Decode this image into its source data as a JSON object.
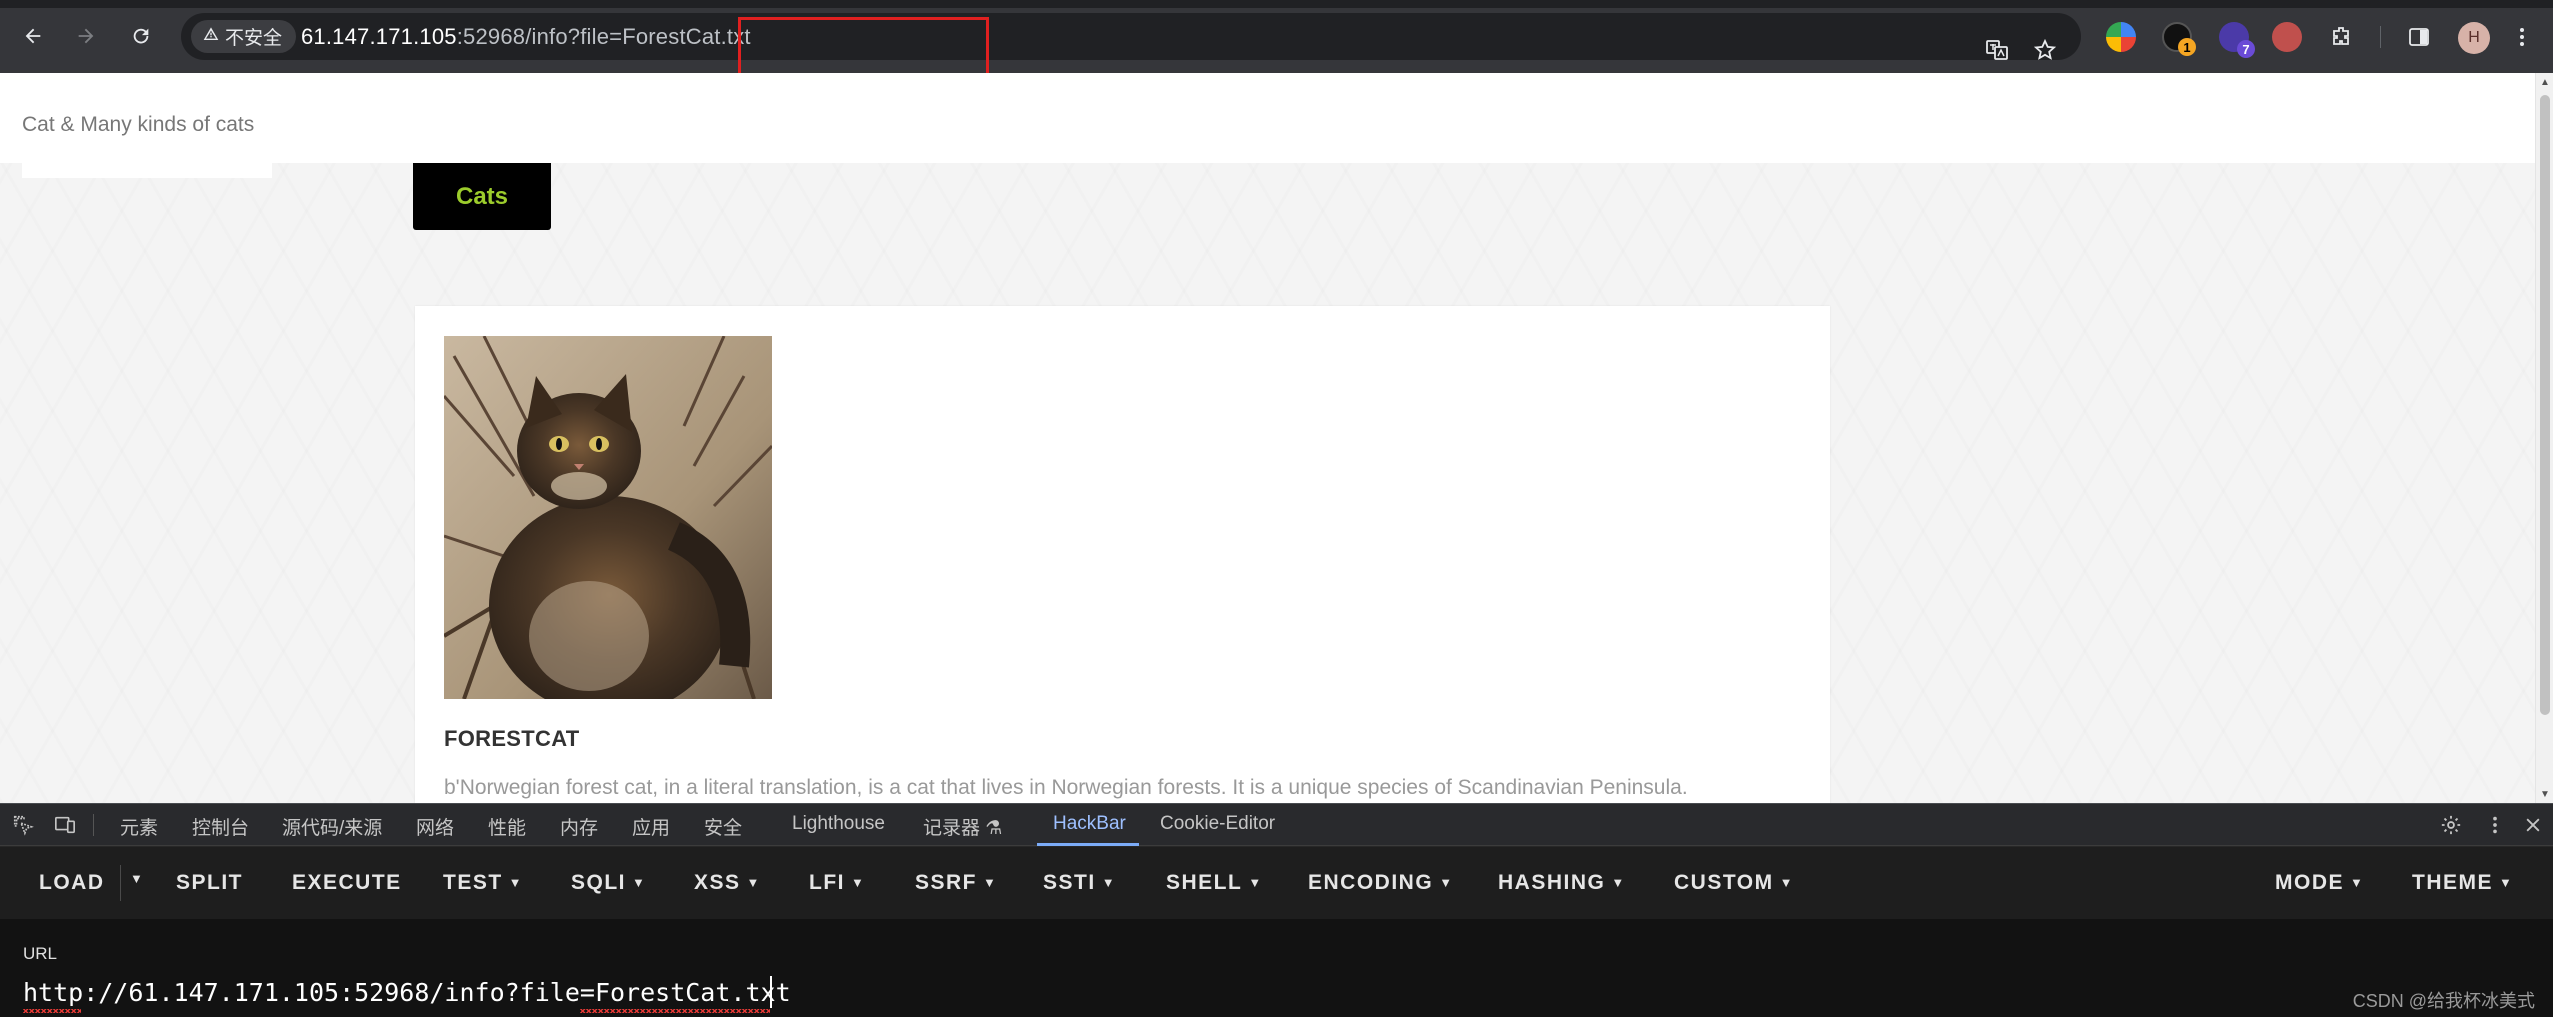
{
  "browser": {
    "security_label": "不安全",
    "url_host": "61.147.171.105",
    "url_rest": ":52968/info?file=ForestCat.txt",
    "accent": "#e02020",
    "extension_badges": [
      "1",
      "7"
    ],
    "profile_initial": "H",
    "icons": [
      "back-icon",
      "forward-icon",
      "reload-icon",
      "warning-icon",
      "translate-icon",
      "star-icon",
      "puzzle-icon",
      "sidepanel-icon"
    ]
  },
  "page": {
    "brand": "Cat & Many kinds of cats",
    "nav_button": "Cats",
    "nav_button_color": "#9ccc2c",
    "card": {
      "title": "FORESTCAT",
      "description": "b'Norwegian forest cat, in a literal translation, is a cat that lives in Norwegian forests. It is a unique species of Scandinavian Peninsula."
    }
  },
  "devtools": {
    "tabs": [
      "元素",
      "控制台",
      "源代码/来源",
      "网络",
      "性能",
      "内存",
      "应用",
      "安全",
      "Lighthouse",
      "记录器 ⚗",
      "HackBar",
      "Cookie-Editor"
    ],
    "active_tab": "HackBar",
    "active_color": "#7cacf8"
  },
  "hackbar": {
    "buttons": [
      "LOAD",
      "SPLIT",
      "EXECUTE",
      "TEST",
      "SQLI",
      "XSS",
      "LFI",
      "SSRF",
      "SSTI",
      "SHELL",
      "ENCODING",
      "HASHING",
      "CUSTOM"
    ],
    "right_buttons": [
      "MODE",
      "THEME"
    ],
    "url_label": "URL",
    "url_value": "http://61.147.171.105:52968/info?file=ForestCat.txt"
  },
  "watermark": "CSDN @给我杯冰美式"
}
